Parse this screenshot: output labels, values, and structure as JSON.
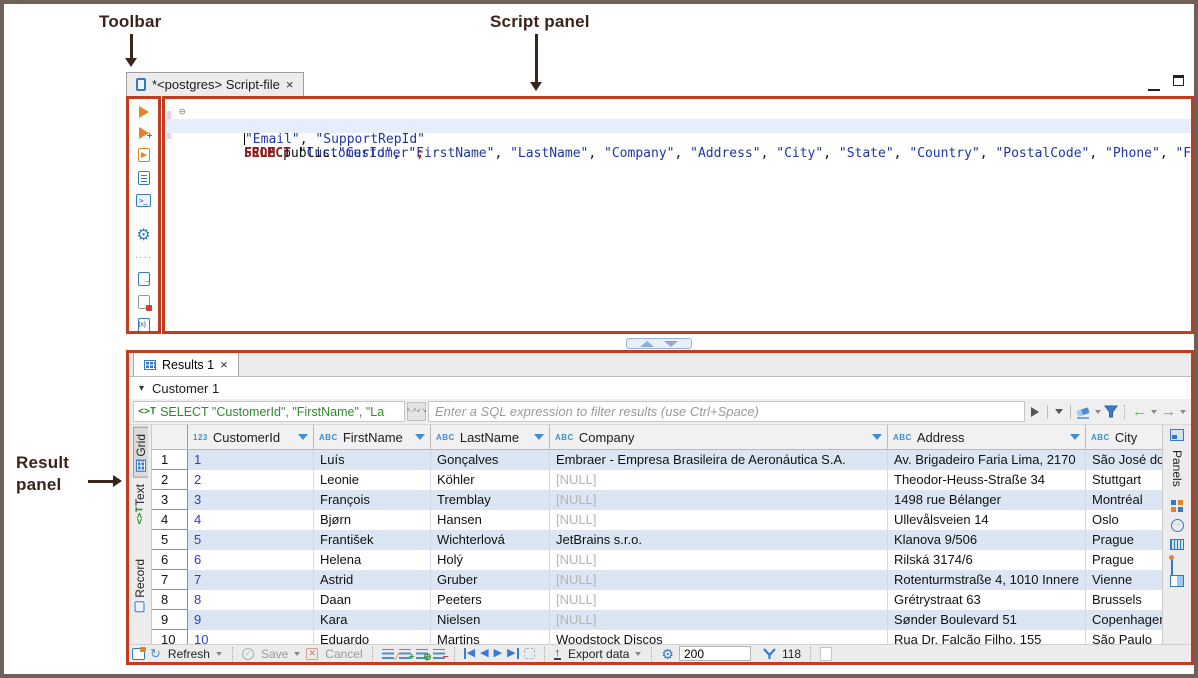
{
  "colors": {
    "panel_border": "#c53b20",
    "frame": "#6f6159",
    "annotation_text": "#3a251d",
    "accent_blue": "#3779be",
    "accent_orange": "#e8822a",
    "accent_green": "#35a035",
    "row_stripe": "#dbe6f2",
    "caret_line": "#e6eefb",
    "sql_keyword": "#8b1c1c",
    "sql_string": "#1f35a5"
  },
  "annotations": {
    "toolbar": "Toolbar",
    "script_panel": "Script panel",
    "result_panel_line1": "Result",
    "result_panel_line2": "panel"
  },
  "editor": {
    "tab_title": "*<postgres> Script-file",
    "tab_close": "×",
    "fold_marker": "⊖"
  },
  "sql": {
    "line1": [
      [
        "SELECT",
        "kw"
      ],
      [
        " ",
        "p"
      ],
      [
        "\"CustomerId\"",
        "s"
      ],
      [
        ", ",
        "p"
      ],
      [
        "\"FirstName\"",
        "s"
      ],
      [
        ", ",
        "p"
      ],
      [
        "\"LastName\"",
        "s"
      ],
      [
        ", ",
        "p"
      ],
      [
        "\"Company\"",
        "s"
      ],
      [
        ", ",
        "p"
      ],
      [
        "\"Address\"",
        "s"
      ],
      [
        ", ",
        "p"
      ],
      [
        "\"City\"",
        "s"
      ],
      [
        ", ",
        "p"
      ],
      [
        "\"State\"",
        "s"
      ],
      [
        ", ",
        "p"
      ],
      [
        "\"Country\"",
        "s"
      ],
      [
        ", ",
        "p"
      ],
      [
        "\"PostalCode\"",
        "s"
      ],
      [
        ", ",
        "p"
      ],
      [
        "\"Phone\"",
        "s"
      ],
      [
        ", ",
        "p"
      ],
      [
        "\"Fax\"",
        "s"
      ],
      [
        ",",
        "p"
      ]
    ],
    "line2": [
      [
        "\"Email\"",
        "s"
      ],
      [
        ", ",
        "p"
      ],
      [
        "\"SupportRepId\"",
        "s"
      ]
    ],
    "line3": [
      [
        "FROM",
        "kw"
      ],
      [
        " public.",
        "p"
      ],
      [
        "\"Customer\"",
        "s"
      ],
      [
        ";",
        "sc"
      ]
    ]
  },
  "results": {
    "tab_label": "Results 1",
    "tab_close": "×",
    "group_caret": "▾",
    "group_label": "Customer 1",
    "filter_sql": "SELECT \"CustomerId\", \"FirstName\", \"La",
    "filter_placeholder": "Enter a SQL expression to filter results (use Ctrl+Space)",
    "side_tabs": {
      "grid": "Grid",
      "text": "Text",
      "record": "Record"
    },
    "panels_label": "Panels",
    "columns": [
      {
        "type": "123",
        "name": "CustomerId",
        "sort": true
      },
      {
        "type": "ABC",
        "name": "FirstName",
        "sort": true
      },
      {
        "type": "ABC",
        "name": "LastName",
        "sort": true
      },
      {
        "type": "ABC",
        "name": "Company",
        "sort": true
      },
      {
        "type": "ABC",
        "name": "Address",
        "sort": true
      },
      {
        "type": "ABC",
        "name": "City",
        "sort": false
      }
    ],
    "null_text": "[NULL]",
    "rows": [
      {
        "num": "1",
        "cells": [
          "1",
          "Luís",
          "Gonçalves",
          "Embraer - Empresa Brasileira de Aeronáutica S.A.",
          "Av. Brigadeiro Faria Lima, 2170",
          "São José dos Campos"
        ]
      },
      {
        "num": "2",
        "cells": [
          "2",
          "Leonie",
          "Köhler",
          "[NULL]",
          "Theodor-Heuss-Straße 34",
          "Stuttgart"
        ]
      },
      {
        "num": "3",
        "cells": [
          "3",
          "François",
          "Tremblay",
          "[NULL]",
          "1498 rue Bélanger",
          "Montréal"
        ]
      },
      {
        "num": "4",
        "cells": [
          "4",
          "Bjørn",
          "Hansen",
          "[NULL]",
          "Ullevålsveien 14",
          "Oslo"
        ]
      },
      {
        "num": "5",
        "cells": [
          "5",
          "František",
          "Wichterlová",
          "JetBrains s.r.o.",
          "Klanova 9/506",
          "Prague"
        ]
      },
      {
        "num": "6",
        "cells": [
          "6",
          "Helena",
          "Holý",
          "[NULL]",
          "Rilská 3174/6",
          "Prague"
        ]
      },
      {
        "num": "7",
        "cells": [
          "7",
          "Astrid",
          "Gruber",
          "[NULL]",
          "Rotenturmstraße 4, 1010 Innere",
          "Vienne"
        ]
      },
      {
        "num": "8",
        "cells": [
          "8",
          "Daan",
          "Peeters",
          "[NULL]",
          "Grétrystraat 63",
          "Brussels"
        ]
      },
      {
        "num": "9",
        "cells": [
          "9",
          "Kara",
          "Nielsen",
          "[NULL]",
          "Sønder Boulevard 51",
          "Copenhagen"
        ]
      },
      {
        "num": "10",
        "cells": [
          "10",
          "Eduardo",
          "Martins",
          "Woodstock Discos",
          "Rua Dr. Falcão Filho, 155",
          "São Paulo"
        ]
      }
    ],
    "toolbar": {
      "refresh": "Refresh",
      "save": "Save",
      "cancel": "Cancel",
      "export": "Export data",
      "fetch_size": "200",
      "row_count": "118"
    }
  }
}
